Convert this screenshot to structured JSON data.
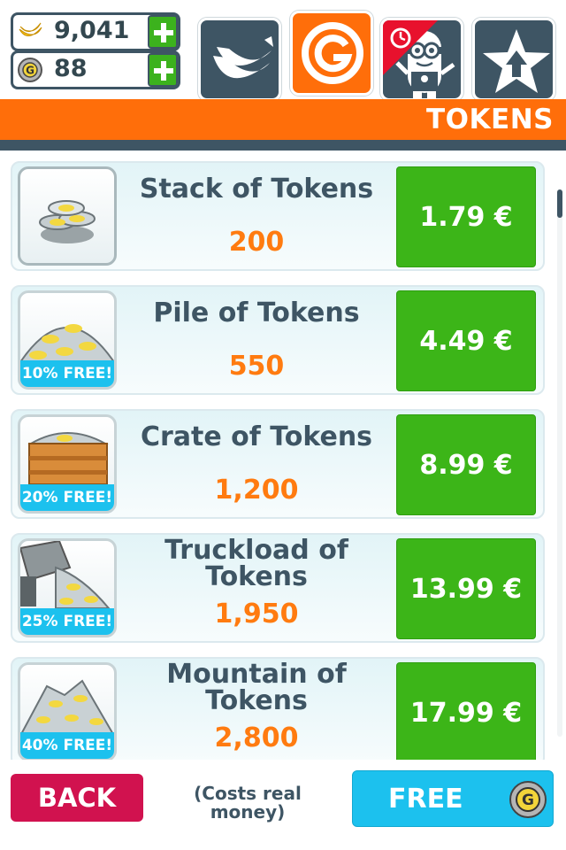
{
  "currencies": {
    "bananas": {
      "value": "9,041",
      "icon": "banana-icon"
    },
    "tokens": {
      "value": "88",
      "icon": "token-coin-icon"
    }
  },
  "tabs": [
    {
      "name": "bananas",
      "icon": "banana-bunch-icon",
      "active": false
    },
    {
      "name": "tokens",
      "icon": "token-g-icon",
      "active": true
    },
    {
      "name": "minions",
      "icon": "minion-icon",
      "active": false,
      "badge_icon": "timer-icon"
    },
    {
      "name": "upgrades",
      "icon": "star-arrow-icon",
      "active": false
    }
  ],
  "header": {
    "title": "TOKENS"
  },
  "offers": [
    {
      "name_line1": "Stack of Tokens",
      "name_line2": "",
      "amount": "200",
      "price": "1.79 €",
      "badge": ""
    },
    {
      "name_line1": "Pile of Tokens",
      "name_line2": "",
      "amount": "550",
      "price": "4.49 €",
      "badge": "10% FREE!"
    },
    {
      "name_line1": "Crate of Tokens",
      "name_line2": "",
      "amount": "1,200",
      "price": "8.99 €",
      "badge": "20% FREE!"
    },
    {
      "name_line1": "Truckload of",
      "name_line2": "Tokens",
      "amount": "1,950",
      "price": "13.99 €",
      "badge": "25% FREE!"
    },
    {
      "name_line1": "Mountain of",
      "name_line2": "Tokens",
      "amount": "2,800",
      "price": "17.99 €",
      "badge": "40% FREE!"
    }
  ],
  "footer": {
    "back_label": "BACK",
    "note_line1": "(Costs real",
    "note_line2": "money)",
    "free_label": "FREE"
  },
  "colors": {
    "orange": "#ff6e0a",
    "slate": "#3e5564",
    "green": "#3cb518",
    "cyan": "#1cc1ee",
    "crimson": "#d1124f"
  }
}
